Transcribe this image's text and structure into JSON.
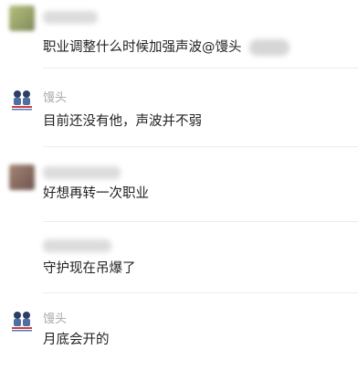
{
  "comments": [
    {
      "user": "",
      "text": "职业调整什么时候加强声波@馒头",
      "avatar_color": "#9aa070"
    },
    {
      "user": "馒头",
      "text": "目前还没有他，声波并不弱",
      "avatar_icon": "cartoon-avatar-icon"
    },
    {
      "user": "",
      "text": "好想再转一次职业",
      "avatar_color": "#8c6f64"
    },
    {
      "user": "",
      "text": "守护现在吊爆了"
    },
    {
      "user": "馒头",
      "text": "月底会开的",
      "avatar_icon": "cartoon-avatar-icon"
    }
  ]
}
